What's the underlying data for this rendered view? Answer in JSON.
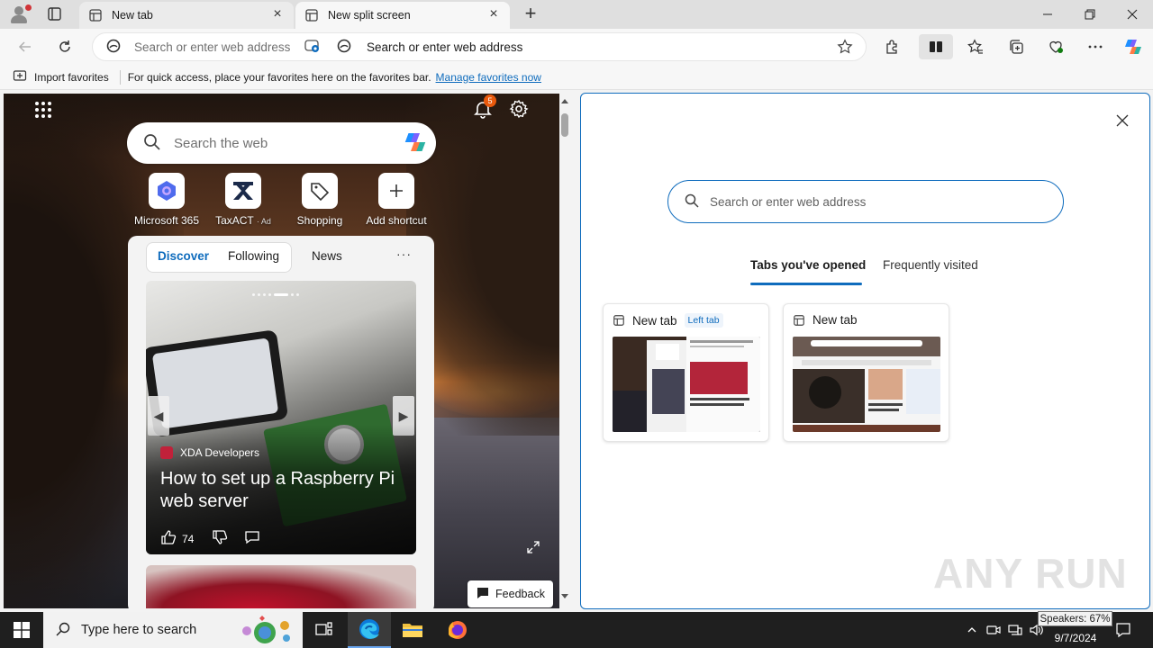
{
  "browser": {
    "tabs": [
      {
        "title": "New tab"
      },
      {
        "title": "New split screen"
      }
    ],
    "new_tab_symbol": "+",
    "window_controls": [
      "minimize",
      "restore",
      "close"
    ]
  },
  "toolbar": {
    "omnibox_left_placeholder": "Search or enter web address",
    "omnibox_right_placeholder": "Search or enter web address"
  },
  "favorites_bar": {
    "import_label": "Import favorites",
    "hint": "For quick access, place your favorites here on the favorites bar.",
    "manage_link": "Manage favorites now"
  },
  "left_pane": {
    "notification_count": "5",
    "search_placeholder": "Search the web",
    "shortcuts": [
      {
        "label": "Microsoft 365"
      },
      {
        "label": "TaxACT",
        "ad": "· Ad"
      },
      {
        "label": "Shopping"
      },
      {
        "label": "Add shortcut"
      }
    ],
    "feed_tabs": [
      "Discover",
      "Following",
      "News"
    ],
    "feed_more": "···",
    "article": {
      "source": "XDA Developers",
      "headline": "How to set up a Raspberry Pi web server",
      "likes": "74"
    },
    "feedback_label": "Feedback"
  },
  "right_pane": {
    "search_placeholder": "Search or enter web address",
    "tabs": [
      "Tabs you've opened",
      "Frequently visited"
    ],
    "cards": [
      {
        "title": "New tab",
        "tag": "Left tab"
      },
      {
        "title": "New tab"
      }
    ]
  },
  "watermark": "ANY RUN",
  "taskbar": {
    "search_placeholder": "Type here to search",
    "time": "9/7/2024",
    "tooltip": "Speakers: 67%"
  },
  "colors": {
    "accent": "#0f6cbd",
    "badge": "#e8590c",
    "taskbar": "#1f1f1f"
  }
}
